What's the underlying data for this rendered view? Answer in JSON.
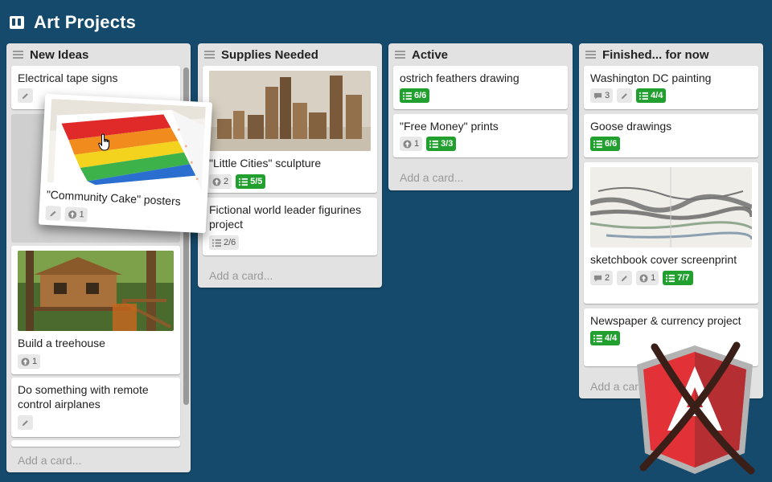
{
  "board": {
    "title": "Art Projects",
    "icon": "board-icon"
  },
  "lists": [
    {
      "title": "New Ideas",
      "cards": [
        {
          "text": "Electrical tape signs",
          "badges": [
            "edit"
          ]
        },
        {
          "text": "Build a treehouse",
          "image": "treehouse",
          "badges": [
            {
              "type": "vote",
              "count": "1"
            }
          ]
        },
        {
          "text": "Do something with remote control airplanes",
          "badges": [
            "edit"
          ]
        }
      ],
      "add_card": "Add a card..."
    },
    {
      "title": "Supplies Needed",
      "cards": [
        {
          "text": "\"Little Cities\" sculpture",
          "image": "cardboard-city",
          "badges": [
            {
              "type": "vote",
              "count": "2"
            },
            {
              "type": "checklist",
              "count": "5/5",
              "complete": true
            }
          ]
        },
        {
          "text": "Fictional world leader figurines project",
          "badges": [
            {
              "type": "checklist",
              "count": "2/6",
              "complete": false
            }
          ]
        }
      ],
      "add_card": "Add a card..."
    },
    {
      "title": "Active",
      "cards": [
        {
          "text": "ostrich feathers drawing",
          "badges": [
            {
              "type": "checklist",
              "count": "6/6",
              "complete": true
            }
          ]
        },
        {
          "text": "\"Free Money\" prints",
          "badges": [
            {
              "type": "vote",
              "count": "1"
            },
            {
              "type": "checklist",
              "count": "3/3",
              "complete": true
            }
          ]
        }
      ],
      "add_card": "Add a card..."
    },
    {
      "title": "Finished... for now",
      "cards": [
        {
          "text": "Washington DC painting",
          "badges": [
            {
              "type": "comment",
              "count": "3"
            },
            "edit",
            {
              "type": "checklist",
              "count": "4/4",
              "complete": true
            }
          ]
        },
        {
          "text": "Goose drawings",
          "badges": [
            {
              "type": "checklist",
              "count": "6/6",
              "complete": true
            }
          ]
        },
        {
          "text": "sketchbook cover screenprint",
          "image": "sketchbook",
          "badges": [
            {
              "type": "comment",
              "count": "2"
            },
            "edit",
            {
              "type": "vote",
              "count": "1"
            },
            {
              "type": "checklist",
              "count": "7/7",
              "complete": true
            }
          ]
        },
        {
          "text": "Newspaper & currency project",
          "badges": [
            {
              "type": "checklist",
              "count": "4/4",
              "complete": true
            }
          ]
        }
      ],
      "add_card": "Add a card..."
    }
  ],
  "dragging_card": {
    "text": "\"Community Cake\" posters",
    "image": "rainbow-cake",
    "badges": [
      "edit",
      {
        "type": "vote",
        "count": "1"
      }
    ]
  },
  "overlay": {
    "icon": "angular-logo-crossed-out"
  },
  "colors": {
    "background": "#154a6c",
    "list": "#e2e2e2",
    "checklist_complete": "#21a030"
  }
}
